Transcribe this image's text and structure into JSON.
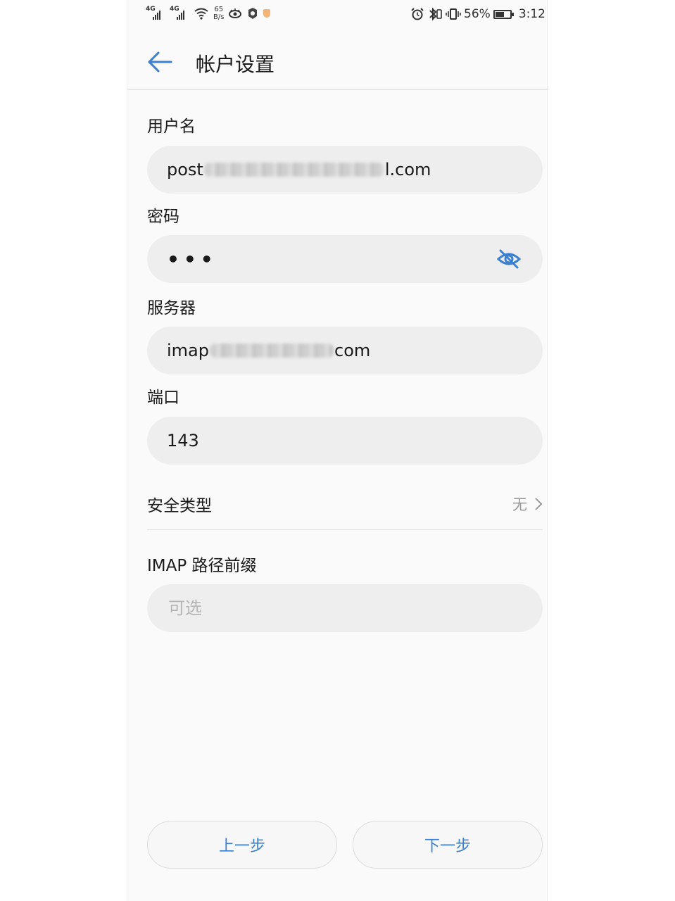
{
  "status_bar": {
    "network_1": "4G",
    "network_2": "4G",
    "speed_value": "65",
    "speed_unit": "B/s",
    "battery": "56%",
    "time": "3:12"
  },
  "header": {
    "title": "帐户设置"
  },
  "form": {
    "username": {
      "label": "用户名",
      "value_prefix": "post",
      "value_suffix": "l.com"
    },
    "password": {
      "label": "密码",
      "value": "•••"
    },
    "server": {
      "label": "服务器",
      "value_prefix": "imap",
      "value_suffix": "com"
    },
    "port": {
      "label": "端口",
      "value": "143"
    },
    "security": {
      "label": "安全类型",
      "value": "无"
    },
    "imap_prefix": {
      "label": "IMAP 路径前缀",
      "placeholder": "可选"
    }
  },
  "buttons": {
    "previous": "上一步",
    "next": "下一步"
  },
  "colors": {
    "accent": "#3b7fd0",
    "field_bg": "#eeeeee"
  }
}
